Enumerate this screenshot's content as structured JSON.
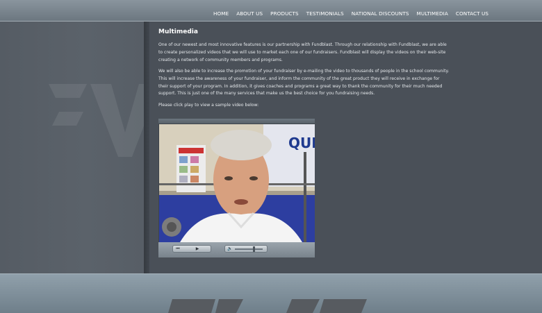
{
  "nav": {
    "items": [
      "HOME",
      "ABOUT US",
      "PRODUCTS",
      "TESTIMONIALS",
      "NATIONAL DISCOUNTS",
      "MULTIMEDIA",
      "CONTACT US"
    ]
  },
  "main": {
    "title": "Multimedia",
    "paragraphs": [
      "One of our newest and most innovative features is our partnership with Fundblast. Through our relationship with Fundblast, we are able to create personalized videos that we will use to market each one of our fundraisers. Fundblast will display the videos on their web-site creating a network of community members and programs.",
      "We will also be able to increase the promotion of your fundraiser by e-mailing the video to thousands of people in the school community. This will increase the awareness of your fundraiser, and inform the community of the great product they will receive in exchange for their support of your program. In addition, it gives coaches and programs a great way to thank the community for their much needed support. This is just one of the many services that make us the best choice for you fundraising needs.",
      "Please click play to view a sample video below:"
    ]
  },
  "video": {
    "wall_sign_text": "QUITE",
    "controls": {
      "rewind_icon": "rewind-icon",
      "play_icon": "play-icon",
      "volume_icon": "volume-icon",
      "volume_level": 0.62
    }
  },
  "colors": {
    "header": "#7a858e",
    "content_bg": "#4a5058",
    "text": "#ffffff",
    "footer": "#7f8f9a"
  }
}
